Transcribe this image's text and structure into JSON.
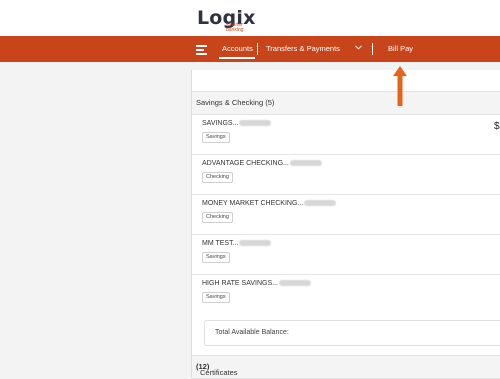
{
  "header": {
    "brand": "Logix",
    "tagline": "smarter banking"
  },
  "nav": {
    "accounts": "Accounts",
    "transfers": "Transfers & Payments",
    "bill_pay": "Bill Pay"
  },
  "colors": {
    "brand": "#c8441a",
    "arrow": "#e8631a"
  },
  "sections": {
    "savings_checking": "Savings & Checking (5)",
    "certificates_label": "Certificates",
    "certificates_count": "(12)"
  },
  "accounts": [
    {
      "name": "SAVINGS...",
      "type": "Savings"
    },
    {
      "name": "ADVANTAGE CHECKING...",
      "type": "Checking"
    },
    {
      "name": "MONEY MARKET CHECKING...",
      "type": "Checking"
    },
    {
      "name": "MM TEST...",
      "type": "Savings"
    },
    {
      "name": "HIGH RATE SAVINGS...",
      "type": "Savings"
    }
  ],
  "balance": {
    "currency_symbol": "$"
  },
  "total": {
    "label": "Total Available Balance:"
  }
}
